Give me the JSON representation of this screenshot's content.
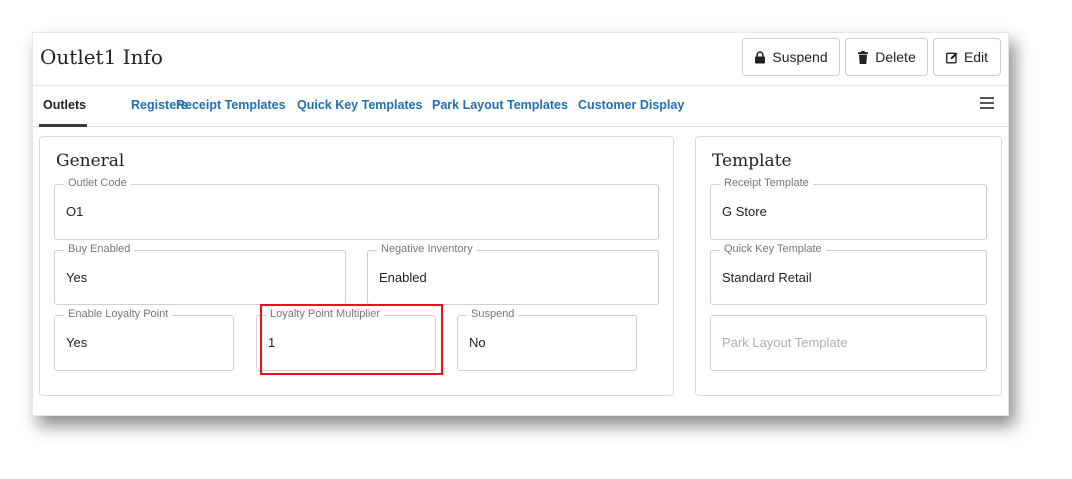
{
  "header": {
    "title": "Outlet1 Info",
    "buttons": {
      "suspend": "Suspend",
      "delete": "Delete",
      "edit": "Edit"
    }
  },
  "tabs": [
    {
      "label": "Outlets",
      "active": true
    },
    {
      "label": "Registers"
    },
    {
      "label": "Receipt Templates"
    },
    {
      "label": "Quick Key Templates"
    },
    {
      "label": "Park Layout Templates"
    },
    {
      "label": "Customer Display"
    }
  ],
  "general": {
    "title": "General",
    "fields": {
      "outlet_code": {
        "label": "Outlet Code",
        "value": "O1"
      },
      "buy_enabled": {
        "label": "Buy Enabled",
        "value": "Yes"
      },
      "negative_inventory": {
        "label": "Negative Inventory",
        "value": "Enabled"
      },
      "enable_loyalty_point": {
        "label": "Enable Loyalty Point",
        "value": "Yes"
      },
      "loyalty_point_multiplier": {
        "label": "Loyalty Point Multiplier",
        "value": "1"
      },
      "suspend": {
        "label": "Suspend",
        "value": "No"
      }
    }
  },
  "template": {
    "title": "Template",
    "fields": {
      "receipt_template": {
        "label": "Receipt Template",
        "value": "G Store"
      },
      "quick_key_template": {
        "label": "Quick Key Template",
        "value": "Standard Retail"
      },
      "park_layout_template": {
        "placeholder": "Park Layout Template"
      }
    }
  },
  "icons": {
    "suspend": "lock-icon",
    "delete": "trash-icon",
    "edit": "edit-icon",
    "menu": "hamburger-menu-icon"
  },
  "colors": {
    "tab_link": "#1f6fb2",
    "highlight": "#e8121a"
  }
}
